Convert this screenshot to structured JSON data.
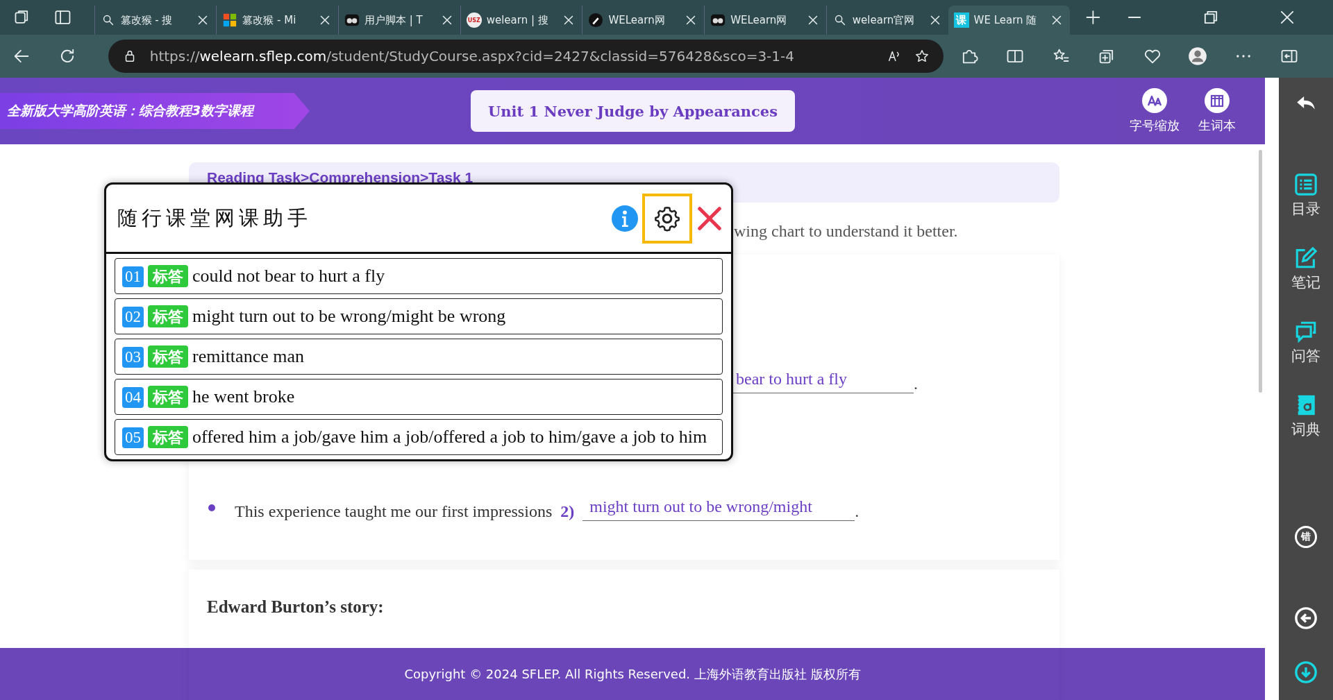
{
  "browser": {
    "tabs": [
      {
        "kind": "search",
        "title": "篡改猴 - 搜",
        "selected": false
      },
      {
        "kind": "windows",
        "title": "篡改猴 - Mi",
        "selected": false
      },
      {
        "kind": "monkey",
        "title": "用户脚本 | T",
        "selected": false
      },
      {
        "kind": "badge",
        "glyph": "USZ",
        "title": "welearn | 搜",
        "selected": false
      },
      {
        "kind": "pen",
        "title": "WELearn网",
        "selected": false
      },
      {
        "kind": "monkey",
        "title": "WELearn网",
        "selected": false
      },
      {
        "kind": "search",
        "title": "welearn官网",
        "selected": false
      },
      {
        "kind": "square",
        "glyph": "课",
        "title": "WE Learn 随",
        "selected": true
      }
    ],
    "url": "https://**welearn.sflep.com**/student/StudyCourse.aspx?cid=2427&classid=576428&sco=3-1-4"
  },
  "header": {
    "course": "全新版大学高阶英语：综合教程3数字课程",
    "unit_title": "Unit 1 Never Judge by Appearances",
    "tools": [
      {
        "kind": "font",
        "label": "字号缩放"
      },
      {
        "kind": "book",
        "label": "生词本"
      }
    ]
  },
  "content": {
    "breadcrumb": "Reading Task>Comprehension>Task 1",
    "instruction_tail": "wing chart to understand it better.",
    "blank_1_tail": "bear to hurt a fly",
    "blank_1_end": ".",
    "sentence_2": "This experience taught me our first impressions",
    "blank_2_number": "2)",
    "blank_2": "might turn out to be wrong/might",
    "blank_2_end": ".",
    "section_heading": "Edward Burton’s story:"
  },
  "assistant": {
    "title": "随行课堂网课助手",
    "settings_highlighted": true,
    "answers": [
      {
        "number": "01",
        "tag": "标答",
        "text": "could not bear to hurt a fly"
      },
      {
        "number": "02",
        "tag": "标答",
        "text": "might turn out to be wrong/might be wrong"
      },
      {
        "number": "03",
        "tag": "标答",
        "text": "remittance man"
      },
      {
        "number": "04",
        "tag": "标答",
        "text": "he went broke"
      },
      {
        "number": "05",
        "tag": "标答",
        "text": "offered him a job/gave him a job/offered a job to him/gave a job to him"
      }
    ]
  },
  "sidebar": {
    "items": [
      {
        "kind": "back"
      },
      {
        "kind": "toc",
        "label": "目录"
      },
      {
        "kind": "note",
        "label": "笔记"
      },
      {
        "kind": "qa",
        "label": "问答"
      },
      {
        "kind": "dict",
        "label": "词典"
      },
      {
        "kind": "mistakes",
        "glyph": "错"
      },
      {
        "kind": "return"
      },
      {
        "kind": "down"
      }
    ]
  },
  "footer": "Copyright © 2024 SFLEP. All Rights Reserved. 上海外语教育出版社 版权所有"
}
